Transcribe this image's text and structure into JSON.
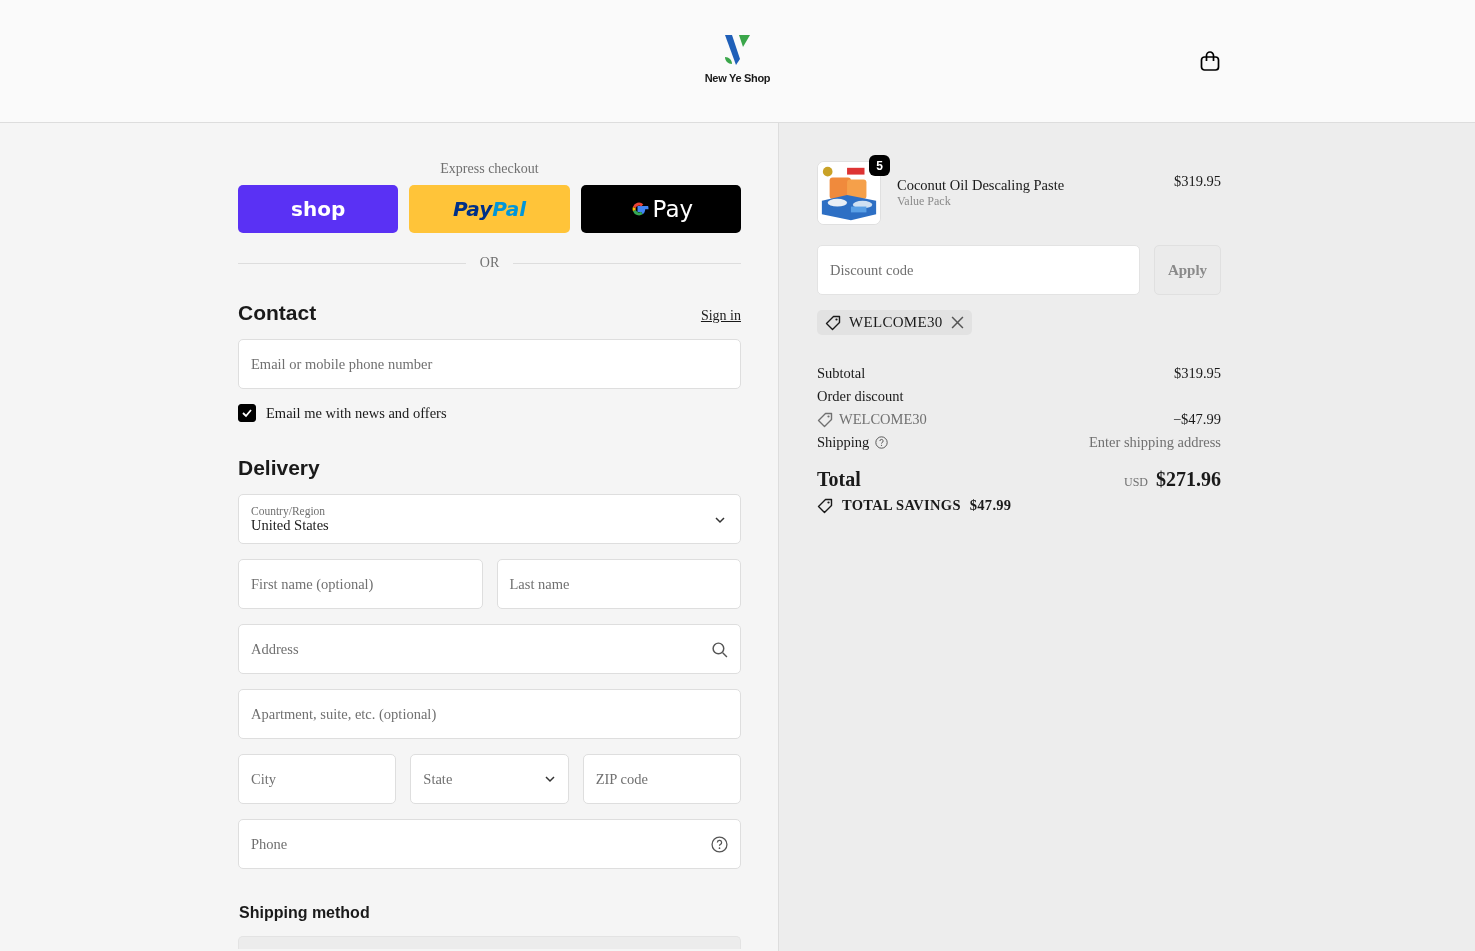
{
  "header": {
    "shop_name": "New Ye Shop"
  },
  "express": {
    "title": "Express checkout",
    "buttons": [
      {
        "kind": "shop",
        "label": "shop"
      },
      {
        "kind": "paypal",
        "label_parts": [
          "Pay",
          "Pal"
        ]
      },
      {
        "kind": "gpay",
        "label": "Pay"
      }
    ],
    "divider": "OR"
  },
  "contact": {
    "heading": "Contact",
    "sign_in": "Sign in",
    "email_placeholder": "Email or mobile phone number",
    "newsletter": {
      "label": "Email me with news and offers",
      "checked": true
    }
  },
  "delivery": {
    "heading": "Delivery",
    "country": {
      "label": "Country/Region",
      "value": "United States"
    },
    "first_name": "First name (optional)",
    "last_name": "Last name",
    "address": "Address",
    "apartment": "Apartment, suite, etc. (optional)",
    "city": "City",
    "state": "State",
    "zip": "ZIP code",
    "phone": "Phone"
  },
  "shipping_method": {
    "heading": "Shipping method"
  },
  "summary": {
    "item": {
      "name": "Coconut Oil Descaling Paste",
      "variant": "Value Pack",
      "price": "$319.95",
      "quantity": "5"
    },
    "discount_placeholder": "Discount code",
    "apply": "Apply",
    "applied_code": "WELCOME30",
    "subtotal_label": "Subtotal",
    "subtotal": "$319.95",
    "order_discount_label": "Order discount",
    "discount_code": "WELCOME30",
    "discount_amount": "−$47.99",
    "shipping_label": "Shipping",
    "shipping_value": "Enter shipping address",
    "total_label": "Total",
    "currency": "USD",
    "total": "$271.96",
    "savings_label": "TOTAL SAVINGS",
    "savings": "$47.99"
  }
}
